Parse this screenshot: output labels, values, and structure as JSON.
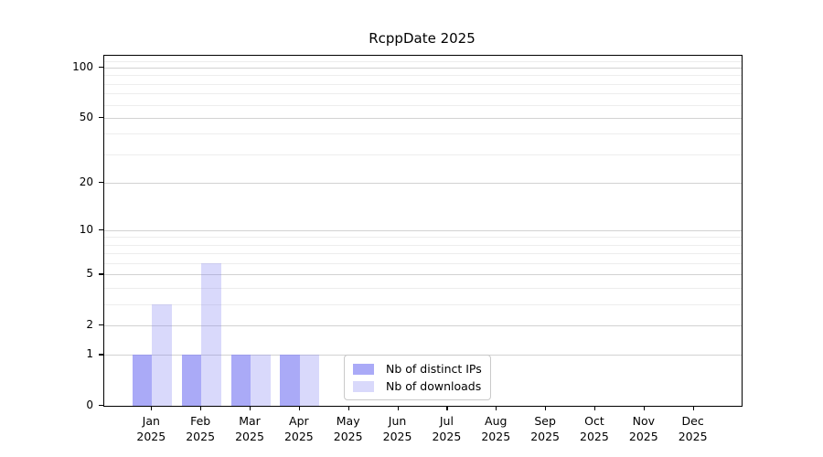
{
  "chart_data": {
    "type": "bar",
    "title": "RcppDate 2025",
    "categories": [
      "Jan",
      "Feb",
      "Mar",
      "Apr",
      "May",
      "Jun",
      "Jul",
      "Aug",
      "Sep",
      "Oct",
      "Nov",
      "Dec"
    ],
    "year_label": "2025",
    "series": [
      {
        "name": "Nb of distinct IPs",
        "color": "rgba(130,130,243,0.68)",
        "values": [
          1,
          1,
          1,
          1,
          0,
          0,
          0,
          0,
          0,
          0,
          0,
          0
        ]
      },
      {
        "name": "Nb of downloads",
        "color": "rgba(130,130,243,0.30)",
        "values": [
          3,
          6,
          1,
          1,
          0,
          0,
          0,
          0,
          0,
          0,
          0,
          0
        ]
      }
    ],
    "xlabel": "",
    "ylabel": "",
    "yscale": "log1p",
    "ylim": [
      0,
      118
    ],
    "yticks": [
      0,
      1,
      2,
      5,
      10,
      20,
      50,
      100
    ],
    "minor_gridlines": [
      3,
      4,
      6,
      7,
      8,
      9,
      30,
      40,
      60,
      70,
      80,
      90,
      110
    ],
    "grid": true,
    "legend_position": "lower center",
    "colors": {
      "axis": "#000000",
      "major_grid": "#d2d2d2",
      "minor_grid": "#ededed",
      "background": "#ffffff"
    }
  }
}
